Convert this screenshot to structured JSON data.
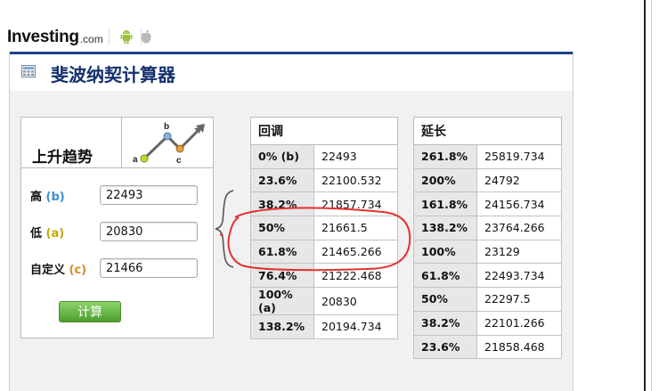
{
  "header": {
    "brand_main": "Investing",
    "brand_suffix": ".com",
    "icons": [
      "android-icon",
      "apple-icon"
    ]
  },
  "panel": {
    "title": "斐波纳契计算器",
    "icon": "calculator-icon"
  },
  "inputs": {
    "trend_label": "上升趋势",
    "diagram_labels": {
      "a": "a",
      "b": "b",
      "c": "c"
    },
    "high": {
      "label_prefix": "高 ",
      "label_tag": "(b)",
      "value": "22493"
    },
    "low": {
      "label_prefix": "低 ",
      "label_tag": "(a)",
      "value": "20830"
    },
    "custom": {
      "label_prefix": "自定义 ",
      "label_tag": "(c)",
      "value": "21466"
    },
    "calc_button": "计算"
  },
  "retracement": {
    "header": "回调",
    "rows": [
      {
        "pct": "0% (b)",
        "value": "22493"
      },
      {
        "pct": "23.6%",
        "value": "22100.532"
      },
      {
        "pct": "38.2%",
        "value": "21857.734"
      },
      {
        "pct": "50%",
        "value": "21661.5"
      },
      {
        "pct": "61.8%",
        "value": "21465.266"
      },
      {
        "pct": "76.4%",
        "value": "21222.468"
      },
      {
        "pct": "100% (a)",
        "value": "20830"
      },
      {
        "pct": "138.2%",
        "value": "20194.734"
      }
    ]
  },
  "extension": {
    "header": "延长",
    "rows": [
      {
        "pct": "261.8%",
        "value": "25819.734"
      },
      {
        "pct": "200%",
        "value": "24792"
      },
      {
        "pct": "161.8%",
        "value": "24156.734"
      },
      {
        "pct": "138.2%",
        "value": "23764.266"
      },
      {
        "pct": "100%",
        "value": "23129"
      },
      {
        "pct": "61.8%",
        "value": "22493.734"
      },
      {
        "pct": "50%",
        "value": "22297.5"
      },
      {
        "pct": "38.2%",
        "value": "22101.266"
      },
      {
        "pct": "23.6%",
        "value": "21858.468"
      }
    ]
  },
  "colors": {
    "title_blue": "#14306e",
    "header_bar": "#1d3f8c",
    "button_green": "#5aab37",
    "annotation_red": "#e53030",
    "point_a": "#c5d92a",
    "point_b": "#8ab4d8",
    "point_c": "#e0a040"
  }
}
